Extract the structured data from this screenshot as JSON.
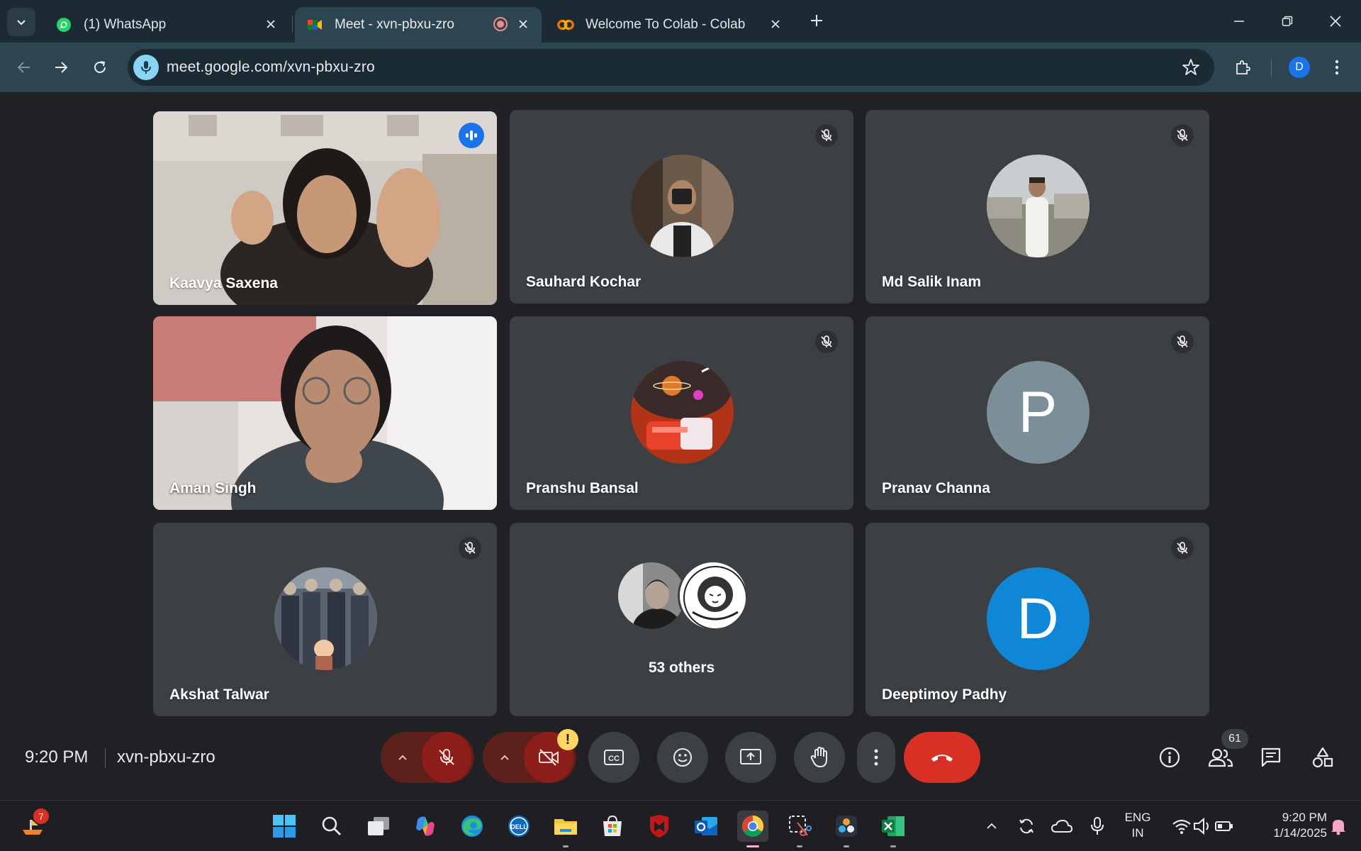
{
  "browser": {
    "tabs": [
      {
        "title": "(1) WhatsApp",
        "active": false
      },
      {
        "title": "Meet - xvn-pbxu-zro",
        "active": true
      },
      {
        "title": "Welcome To Colab - Colab",
        "active": false
      }
    ],
    "url": "meet.google.com/xvn-pbxu-zro",
    "profile_initial": "D"
  },
  "meet": {
    "participants": [
      {
        "name": "Kaavya Saxena",
        "state": "speaking",
        "video": true
      },
      {
        "name": "Sauhard Kochar",
        "muted": true
      },
      {
        "name": "Md Salik Inam",
        "muted": true
      },
      {
        "name": "Aman Singh",
        "video": true
      },
      {
        "name": "Pranshu Bansal",
        "muted": true
      },
      {
        "name": "Pranav Channa",
        "muted": true,
        "initial": "P",
        "color": "#7b8f99"
      },
      {
        "name": "Akshat Talwar",
        "muted": true
      },
      {
        "name": "53 others"
      },
      {
        "name": "Deeptimoy Padhy",
        "muted": true,
        "initial": "D",
        "color": "#0f87d6"
      }
    ],
    "time": "9:20 PM",
    "meeting_code": "xvn-pbxu-zro",
    "participant_count": "61",
    "warning_symbol": "!"
  },
  "taskbar": {
    "weather_badge": "7",
    "lang_line1": "ENG",
    "lang_line2": "IN",
    "time": "9:20 PM",
    "date": "1/14/2025"
  }
}
